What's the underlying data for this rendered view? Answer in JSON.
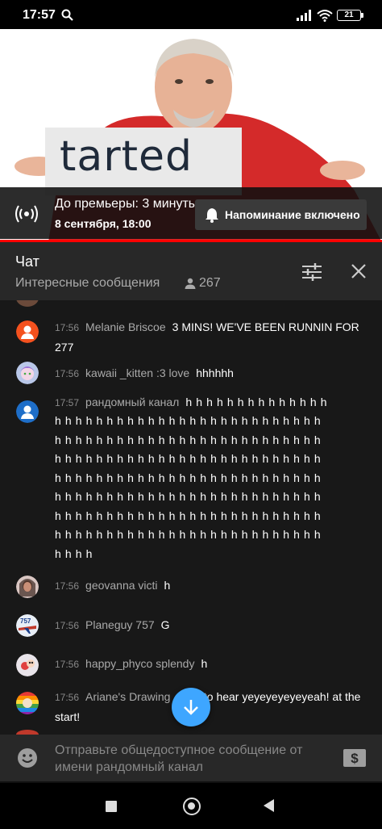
{
  "status_bar": {
    "time": "17:57",
    "battery": "21"
  },
  "video": {
    "overlay_text": "tarted",
    "premiere_title": "До премьеры: 3 минуты",
    "premiere_date": "8 сентября, 18:00",
    "reminder_label": "Напоминание включено",
    "progress_fraction": 1.0,
    "accent": "#ff0000"
  },
  "chat_header": {
    "title": "Чат",
    "mode": "Интересные сообщения",
    "viewers": "267"
  },
  "messages": [
    {
      "time": "17:56",
      "author": "Melanie Briscoe",
      "text": "3 MINS! WE'VE BEEN RUNNIN FOR 277",
      "avatar": "orange-person-avatar"
    },
    {
      "time": "17:56",
      "author": "kawaii _kitten :3 love",
      "text": "hhhhhh",
      "avatar": "anime-avatar"
    },
    {
      "time": "17:57",
      "author": "рандомный канал",
      "text_first": "h h h h h h h h h h h h h h",
      "text_lines": [
        "h h h h h h h h h h h h h h h h h h h h h h h h h h",
        "h h h h h h h h h h h h h h h h h h h h h h h h h h",
        "h h h h h h h h h h h h h h h h h h h h h h h h h h",
        "h h h h h h h h h h h h h h h h h h h h h h h h h h",
        "h h h h h h h h h h h h h h h h h h h h h h h h h h",
        "h h h h h h h h h h h h h h h h h h h h h h h h h h",
        "h h h h h h h h h h h h h h h h h h h h h h h h h h",
        "h h h h"
      ],
      "avatar": "blue-person-avatar"
    },
    {
      "time": "17:56",
      "author": "geovanna victi",
      "text": "h",
      "avatar": "photo-avatar"
    },
    {
      "time": "17:56",
      "author": "Planeguy 757",
      "text": "G",
      "avatar": "plane-avatar"
    },
    {
      "time": "17:56",
      "author": "happy_phyco splendy",
      "text": "h",
      "avatar": "cartoon-avatar"
    },
    {
      "time": "17:56",
      "author": "Ariane's Drawing",
      "text": "want to hear yeyeyeyeyeyeah! at the start!",
      "avatar": "rainbow-avatar"
    }
  ],
  "composer": {
    "placeholder": "Отправьте общедоступное сообщение от имени рандомный канал"
  },
  "colors": {
    "scroll_button": "#3ea6ff",
    "chat_bg": "#181818",
    "header_bg": "#282828"
  }
}
